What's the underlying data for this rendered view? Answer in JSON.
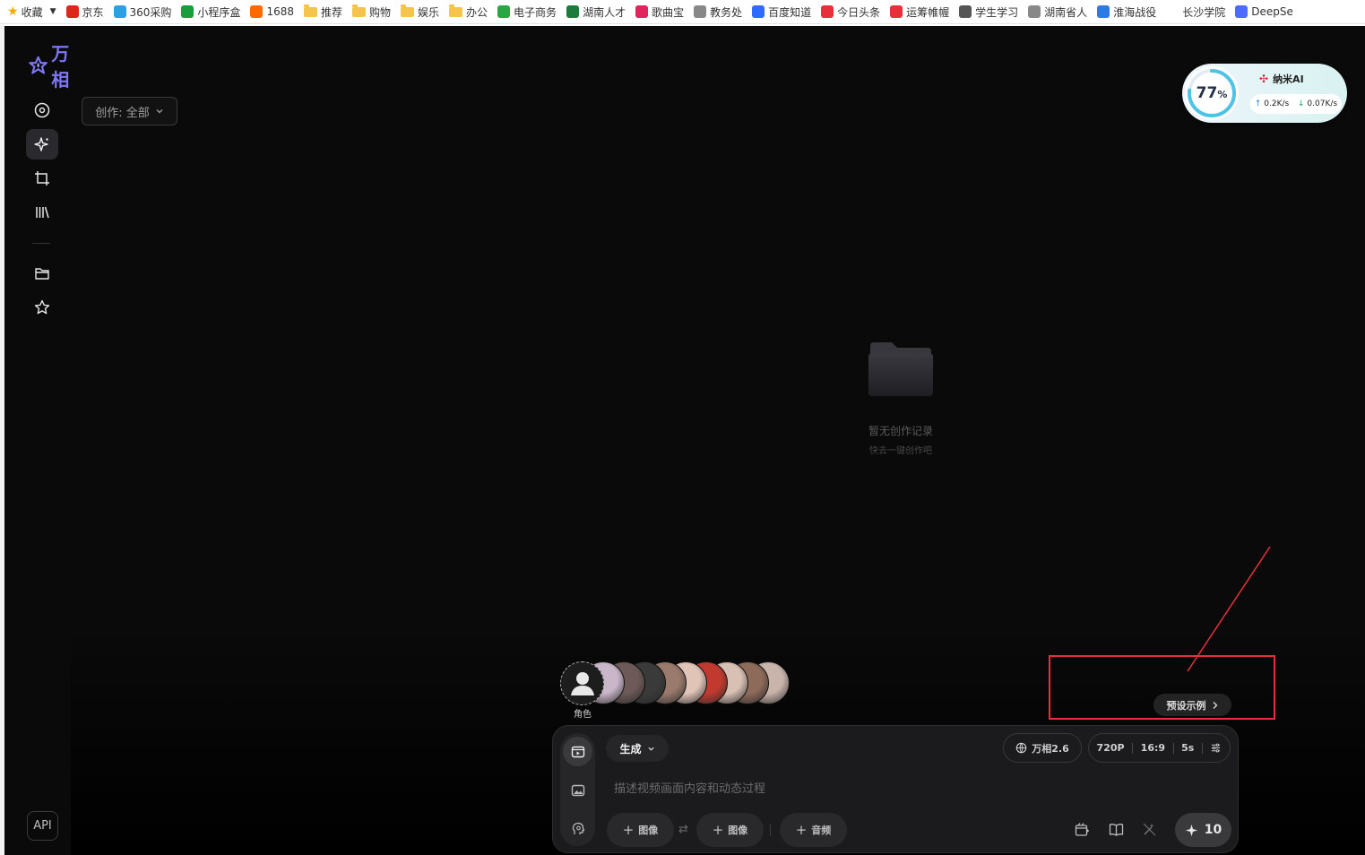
{
  "bookmarks": [
    {
      "label": "收藏",
      "icon": "star-icon",
      "color": "#f2a900"
    },
    {
      "label": "京东",
      "icon": "jd-icon",
      "color": "#e1251b"
    },
    {
      "label": "360采购",
      "icon": "360-icon",
      "color": "#2e9fe6"
    },
    {
      "label": "小程序盒",
      "icon": "shield-icon",
      "color": "#1a9e3b"
    },
    {
      "label": "1688",
      "icon": "1688-icon",
      "color": "#ff6a00"
    },
    {
      "label": "推荐",
      "icon": "folder-icon",
      "color": "#f5c54b"
    },
    {
      "label": "购物",
      "icon": "folder-icon",
      "color": "#f5c54b"
    },
    {
      "label": "娱乐",
      "icon": "folder-icon",
      "color": "#f5c54b"
    },
    {
      "label": "办公",
      "icon": "folder-icon",
      "color": "#f5c54b"
    },
    {
      "label": "电子商务",
      "icon": "search-icon",
      "color": "#28a745"
    },
    {
      "label": "湖南人才",
      "icon": "hunan-icon",
      "color": "#1c7c3c"
    },
    {
      "label": "歌曲宝",
      "icon": "music-icon",
      "color": "#e0245e"
    },
    {
      "label": "教务处",
      "icon": "globe-icon",
      "color": "#888888"
    },
    {
      "label": "百度知道",
      "icon": "baidu-icon",
      "color": "#2f6bff"
    },
    {
      "label": "今日头条",
      "icon": "toutiao-icon",
      "color": "#e8303a"
    },
    {
      "label": "运筹帷幄",
      "icon": "toutiao-icon",
      "color": "#e8303a"
    },
    {
      "label": "学生学习",
      "icon": "globe-icon",
      "color": "#555555"
    },
    {
      "label": "湖南省人",
      "icon": "globe-icon",
      "color": "#888888"
    },
    {
      "label": "淮海战役",
      "icon": "tv-icon",
      "color": "#2f7ae0"
    },
    {
      "label": "长沙学院",
      "icon": "blank-icon",
      "color": "#ffffff"
    },
    {
      "label": "DeepSe",
      "icon": "deepseek-icon",
      "color": "#4d6bfe"
    }
  ],
  "brand": {
    "name": "万相",
    "color": "#7e76f5"
  },
  "sidebar": {
    "items": [
      {
        "name": "explore",
        "icon": "compass-icon"
      },
      {
        "name": "create",
        "icon": "sparkle-icon",
        "active": true
      },
      {
        "name": "crop",
        "icon": "crop-icon"
      },
      {
        "name": "library",
        "icon": "library-icon"
      },
      {
        "name": "folder",
        "icon": "folder-icon"
      },
      {
        "name": "favorites",
        "icon": "star-icon"
      }
    ],
    "api_label": "API"
  },
  "filter": {
    "label": "创作: 全部"
  },
  "empty_state": {
    "title": "暂无创作记录",
    "subtitle": "快去一键创作吧"
  },
  "network_widget": {
    "percent": "77",
    "percent_value": 77,
    "percent_unit": "%",
    "brand": "纳米AI",
    "upload": "0.2K/s",
    "download": "0.07K/s"
  },
  "characters": {
    "label": "角色",
    "avatar_colors": [
      "#c9b6c8",
      "#6d5a58",
      "#3a3a3a",
      "#9a7a6c",
      "#e0c4b8",
      "#c23a2f",
      "#d8c0b4",
      "#8e6a5a",
      "#c9b4ab"
    ]
  },
  "preset": {
    "label": "预设示例"
  },
  "composer": {
    "mode": "生成",
    "model": "万相2.6",
    "resolution": "720P",
    "ratio": "16:9",
    "duration": "5s",
    "placeholder": "描述视频画面内容和动态过程",
    "add_image_1": "图像",
    "add_image_2": "图像",
    "add_audio": "音频",
    "credits": "10"
  },
  "colors": {
    "annotation": "#e8303a",
    "background": "#0a0a0a",
    "composer": "#1b1b1d"
  }
}
